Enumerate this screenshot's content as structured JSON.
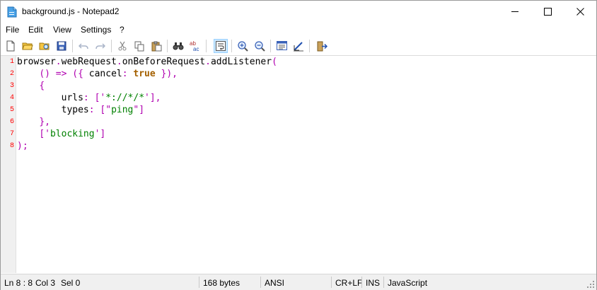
{
  "window": {
    "title": "background.js - Notepad2"
  },
  "menu": {
    "items": [
      "File",
      "Edit",
      "View",
      "Settings",
      "?"
    ]
  },
  "toolbar": {
    "buttons": [
      "new-file-icon",
      "open-file-icon",
      "browse-icon",
      "save-icon",
      "undo-icon",
      "redo-icon",
      "cut-icon",
      "copy-icon",
      "paste-icon",
      "find-icon",
      "replace-icon",
      "word-wrap-icon",
      "zoom-in-icon",
      "zoom-out-icon",
      "select-scheme-icon",
      "customize-scheme-icon",
      "exit-icon"
    ]
  },
  "editor": {
    "line_numbers": [
      "1",
      "2",
      "3",
      "4",
      "5",
      "6",
      "7",
      "8"
    ],
    "lines": [
      [
        [
          "id",
          "browser"
        ],
        [
          "op",
          "."
        ],
        [
          "id",
          "webRequest"
        ],
        [
          "op",
          "."
        ],
        [
          "id",
          "onBeforeRequest"
        ],
        [
          "op",
          "."
        ],
        [
          "id",
          "addListener"
        ],
        [
          "op",
          "("
        ]
      ],
      [
        [
          "id",
          "    "
        ],
        [
          "op",
          "() => ({ "
        ],
        [
          "id",
          "cancel"
        ],
        [
          "op",
          ": "
        ],
        [
          "kw",
          "true"
        ],
        [
          "op",
          " }),"
        ]
      ],
      [
        [
          "id",
          "    "
        ],
        [
          "op",
          "{"
        ]
      ],
      [
        [
          "id",
          "        urls"
        ],
        [
          "op",
          ": ['"
        ],
        [
          "str",
          "*://*/*"
        ],
        [
          "op",
          "'],"
        ]
      ],
      [
        [
          "id",
          "        types"
        ],
        [
          "op",
          ": [\""
        ],
        [
          "str",
          "ping"
        ],
        [
          "op",
          "\"]"
        ]
      ],
      [
        [
          "id",
          "    "
        ],
        [
          "op",
          "},"
        ]
      ],
      [
        [
          "id",
          "    "
        ],
        [
          "op",
          "['"
        ],
        [
          "str",
          "blocking"
        ],
        [
          "op",
          "']"
        ]
      ],
      [
        [
          "op",
          ");"
        ]
      ]
    ]
  },
  "status": {
    "position": "Ln 8 : 8",
    "column": "Col 3",
    "selection": "Sel 0",
    "size": "168 bytes",
    "encoding": "ANSI",
    "line_endings": "CR+LF",
    "mode": "INS",
    "scheme": "JavaScript"
  },
  "colors": {
    "identifier": "#000000",
    "operator": "#b000b0",
    "keyword": "#a46000",
    "string": "#008000",
    "line_number": "#ff0000"
  }
}
